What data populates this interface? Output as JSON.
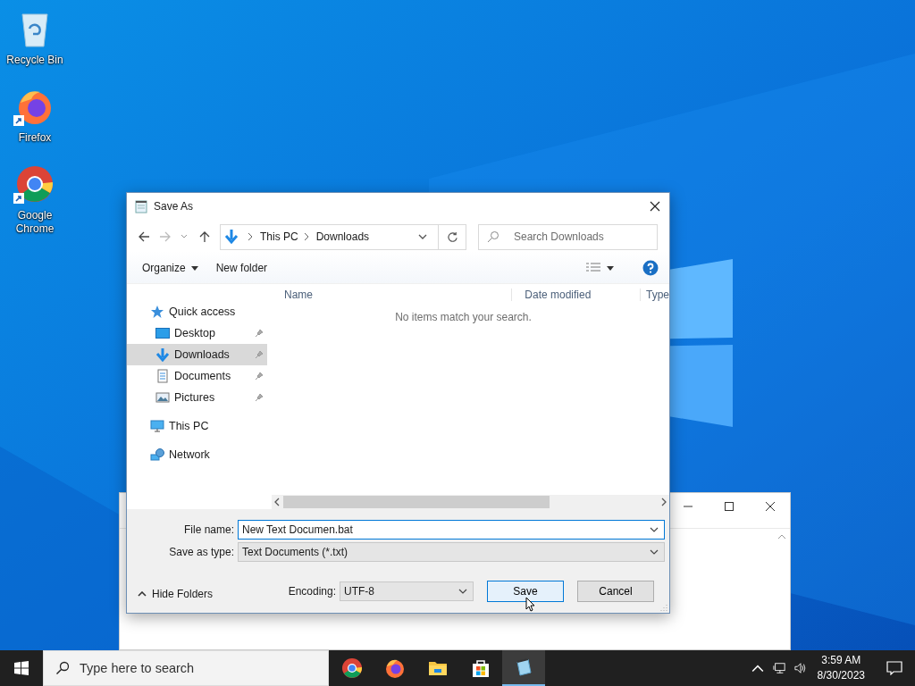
{
  "desktop_icons": [
    {
      "label": "Recycle Bin",
      "kind": "recycle",
      "shortcut": false
    },
    {
      "label": "Firefox",
      "kind": "firefox",
      "shortcut": true
    },
    {
      "label": "Google Chrome",
      "kind": "chrome",
      "shortcut": true
    }
  ],
  "dialog": {
    "title": "Save As",
    "address": {
      "path": [
        "This PC",
        "Downloads"
      ]
    },
    "search": {
      "placeholder": "Search Downloads"
    },
    "toolbar": {
      "organize": "Organize",
      "new_folder": "New folder"
    },
    "sidebar": {
      "items": [
        {
          "label": "Quick access",
          "kind": "star",
          "selected": false,
          "pinned": false,
          "children": [
            {
              "label": "Desktop",
              "kind": "desktop",
              "selected": false,
              "pinned": true
            },
            {
              "label": "Downloads",
              "kind": "download",
              "selected": true,
              "pinned": true
            },
            {
              "label": "Documents",
              "kind": "document",
              "selected": false,
              "pinned": true
            },
            {
              "label": "Pictures",
              "kind": "pictures",
              "selected": false,
              "pinned": true
            }
          ]
        },
        {
          "label": "This PC",
          "kind": "pc",
          "selected": false,
          "pinned": false
        },
        {
          "label": "Network",
          "kind": "network",
          "selected": false,
          "pinned": false
        }
      ]
    },
    "columns": [
      "Name",
      "Date modified",
      "Type"
    ],
    "empty_message": "No items match your search.",
    "file_name": {
      "label": "File name:",
      "value": "New Text Documen.bat"
    },
    "save_as_type": {
      "label": "Save as type:",
      "value": "Text Documents (*.txt)"
    },
    "hide_folders": "Hide Folders",
    "encoding": {
      "label": "Encoding:",
      "value": "UTF-8"
    },
    "buttons": [
      {
        "label": "Save",
        "kind": "default"
      },
      {
        "label": "Cancel",
        "kind": "normal"
      }
    ]
  },
  "taskbar": {
    "search": {
      "placeholder": "Type here to search"
    },
    "apps": [
      {
        "kind": "chrome",
        "active": false
      },
      {
        "kind": "firefox",
        "active": false
      },
      {
        "kind": "explorer",
        "active": false
      },
      {
        "kind": "store",
        "active": false
      },
      {
        "kind": "notepad",
        "active": true
      }
    ],
    "time": "3:59 AM",
    "date": "8/30/2023"
  }
}
